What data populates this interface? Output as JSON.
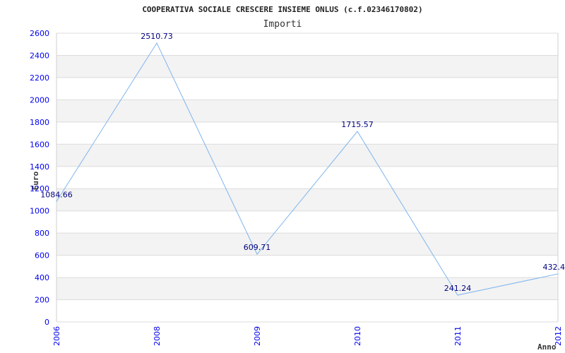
{
  "chart_data": {
    "type": "line",
    "title": "COOPERATIVA SOCIALE CRESCERE INSIEME ONLUS (c.f.02346170802)",
    "subtitle": "Importi",
    "xlabel": "Anno",
    "ylabel": "Euro",
    "categories": [
      "2006",
      "2008",
      "2009",
      "2010",
      "2011",
      "2012"
    ],
    "values": [
      1084.66,
      2510.73,
      609.71,
      1715.57,
      241.24,
      432.4
    ],
    "data_labels": [
      "1084.66",
      "2510.73",
      "609.71",
      "1715.57",
      "241.24",
      "432.4"
    ],
    "ylim": [
      0,
      2600
    ],
    "yticks": [
      0,
      200,
      400,
      600,
      800,
      1000,
      1200,
      1400,
      1600,
      1800,
      2000,
      2200,
      2400,
      2600
    ],
    "grid": true,
    "banded_background": true,
    "colors": {
      "line": "#7fb5ee",
      "tick_labels": "#0000ee",
      "data_labels": "#000080",
      "band": "#f3f3f3"
    }
  }
}
